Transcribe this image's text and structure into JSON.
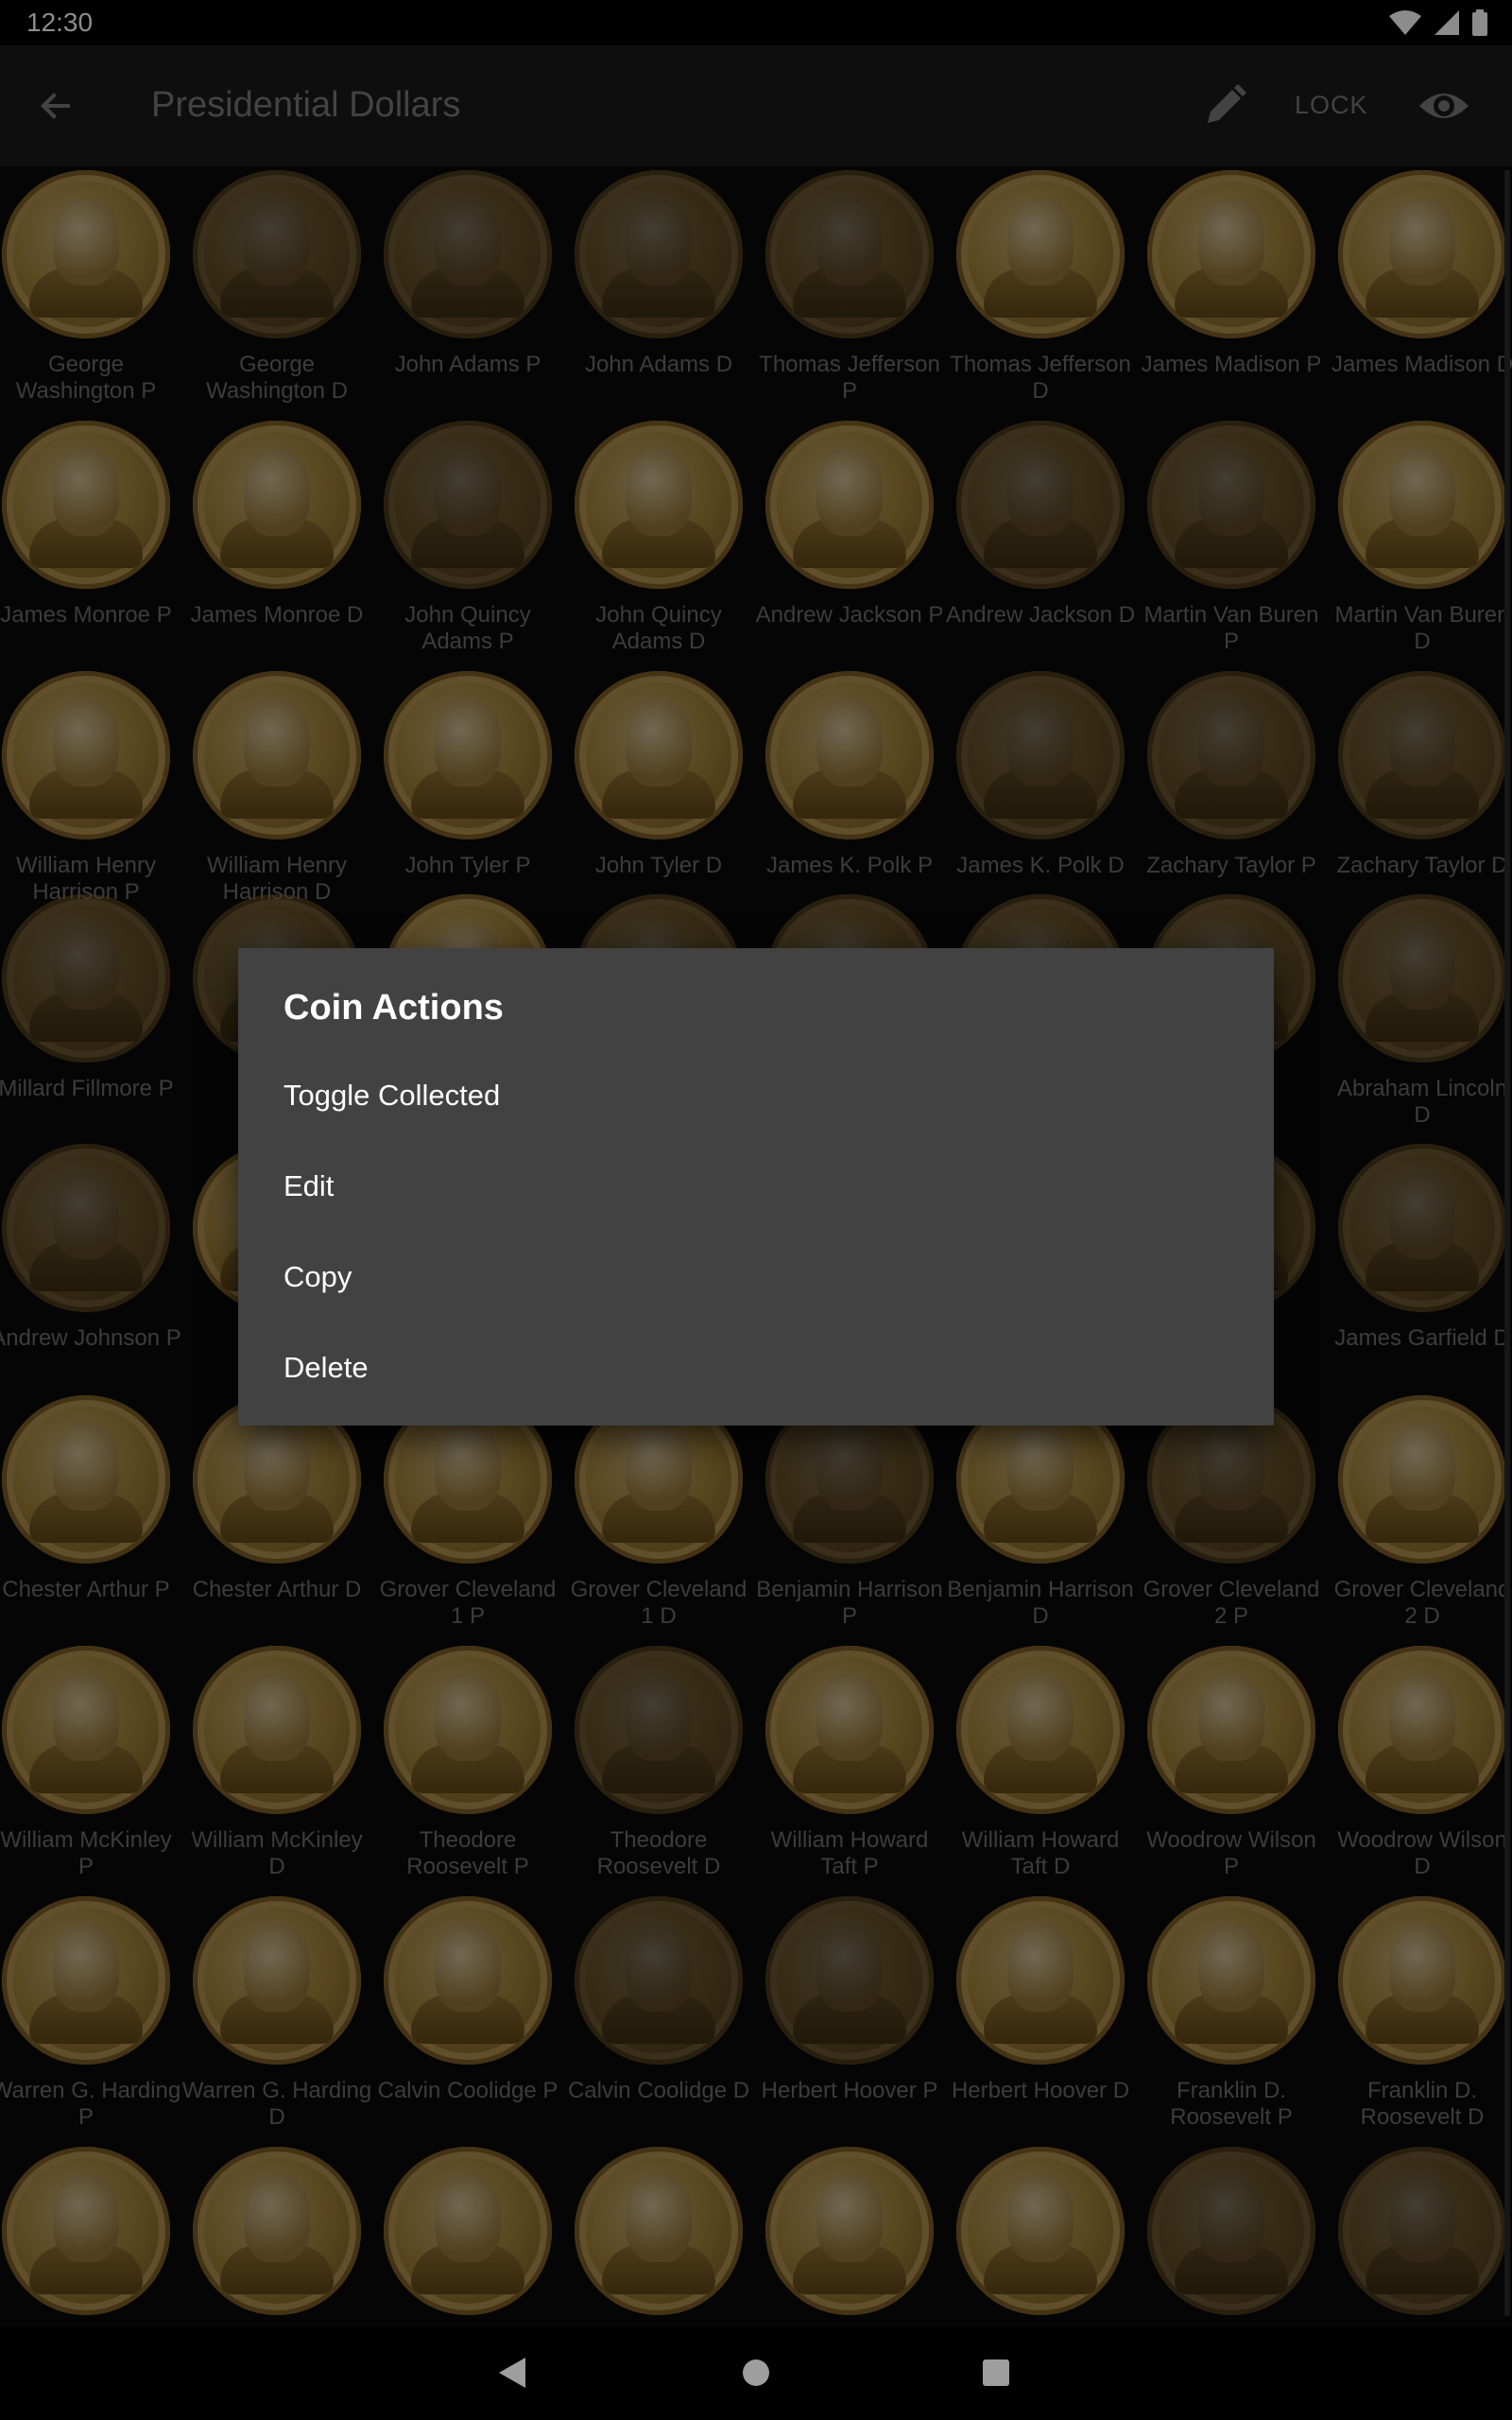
{
  "status_bar": {
    "time": "12:30"
  },
  "app_bar": {
    "title": "Presidential Dollars",
    "lock_label": "LOCK"
  },
  "coins": [
    {
      "name": "George Washington P",
      "collected": true
    },
    {
      "name": "George Washington D",
      "collected": false
    },
    {
      "name": "John Adams P",
      "collected": false
    },
    {
      "name": "John Adams D",
      "collected": false
    },
    {
      "name": "Thomas Jefferson P",
      "collected": false
    },
    {
      "name": "Thomas Jefferson D",
      "collected": true
    },
    {
      "name": "James Madison P",
      "collected": true
    },
    {
      "name": "James Madison D",
      "collected": true
    },
    {
      "name": "James Monroe P",
      "collected": true
    },
    {
      "name": "James Monroe D",
      "collected": true
    },
    {
      "name": "John Quincy Adams P",
      "collected": false
    },
    {
      "name": "John Quincy Adams D",
      "collected": true
    },
    {
      "name": "Andrew Jackson P",
      "collected": true
    },
    {
      "name": "Andrew Jackson D",
      "collected": false
    },
    {
      "name": "Martin Van Buren P",
      "collected": false
    },
    {
      "name": "Martin Van Buren D",
      "collected": true
    },
    {
      "name": "William Henry Harrison P",
      "collected": true
    },
    {
      "name": "William Henry Harrison D",
      "collected": true
    },
    {
      "name": "John Tyler P",
      "collected": true
    },
    {
      "name": "John Tyler D",
      "collected": true
    },
    {
      "name": "James K. Polk P",
      "collected": true
    },
    {
      "name": "James K. Polk D",
      "collected": false
    },
    {
      "name": "Zachary Taylor P",
      "collected": false
    },
    {
      "name": "Zachary Taylor D",
      "collected": false
    },
    {
      "name": "Millard Fillmore P",
      "collected": false
    },
    {
      "name": "Mill",
      "collected": false
    },
    {
      "name": "",
      "collected": true
    },
    {
      "name": "",
      "collected": false
    },
    {
      "name": "",
      "collected": false
    },
    {
      "name": "",
      "collected": false
    },
    {
      "name": "coln",
      "collected": false
    },
    {
      "name": "Abraham Lincoln D",
      "collected": false
    },
    {
      "name": "Andrew Johnson P",
      "collected": false
    },
    {
      "name": "Andr",
      "collected": true
    },
    {
      "name": "",
      "collected": false
    },
    {
      "name": "",
      "collected": false
    },
    {
      "name": "",
      "collected": false
    },
    {
      "name": "",
      "collected": false
    },
    {
      "name": "eld P",
      "collected": false
    },
    {
      "name": "James Garfield D",
      "collected": false
    },
    {
      "name": "Chester Arthur P",
      "collected": true
    },
    {
      "name": "Chester Arthur D",
      "collected": true
    },
    {
      "name": "Grover Cleveland 1 P",
      "collected": true
    },
    {
      "name": "Grover Cleveland 1 D",
      "collected": true
    },
    {
      "name": "Benjamin Harrison P",
      "collected": false
    },
    {
      "name": "Benjamin Harrison D",
      "collected": true
    },
    {
      "name": "Grover Cleveland 2 P",
      "collected": false
    },
    {
      "name": "Grover Cleveland 2 D",
      "collected": true
    },
    {
      "name": "William McKinley P",
      "collected": true
    },
    {
      "name": "William McKinley D",
      "collected": true
    },
    {
      "name": "Theodore Roosevelt P",
      "collected": true
    },
    {
      "name": "Theodore Roosevelt D",
      "collected": false
    },
    {
      "name": "William Howard Taft P",
      "collected": true
    },
    {
      "name": "William Howard Taft D",
      "collected": true
    },
    {
      "name": "Woodrow Wilson P",
      "collected": true
    },
    {
      "name": "Woodrow Wilson D",
      "collected": true
    },
    {
      "name": "Warren G. Harding P",
      "collected": true
    },
    {
      "name": "Warren G. Harding D",
      "collected": true
    },
    {
      "name": "Calvin Coolidge P",
      "collected": true
    },
    {
      "name": "Calvin Coolidge D",
      "collected": false
    },
    {
      "name": "Herbert Hoover P",
      "collected": false
    },
    {
      "name": "Herbert Hoover D",
      "collected": true
    },
    {
      "name": "Franklin D. Roosevelt P",
      "collected": true
    },
    {
      "name": "Franklin D. Roosevelt D",
      "collected": true
    },
    {
      "name": "",
      "collected": true
    },
    {
      "name": "",
      "collected": true
    },
    {
      "name": "",
      "collected": true
    },
    {
      "name": "",
      "collected": true
    },
    {
      "name": "",
      "collected": true
    },
    {
      "name": "",
      "collected": true
    },
    {
      "name": "",
      "collected": false
    },
    {
      "name": "",
      "collected": false
    }
  ],
  "dialog": {
    "title": "Coin Actions",
    "items": [
      "Toggle Collected",
      "Edit",
      "Copy",
      "Delete"
    ]
  },
  "colors": {
    "dialog_bg": "#424242",
    "app_bar_bg": "#1a1a1a",
    "coin_gold": "#b8923f"
  }
}
